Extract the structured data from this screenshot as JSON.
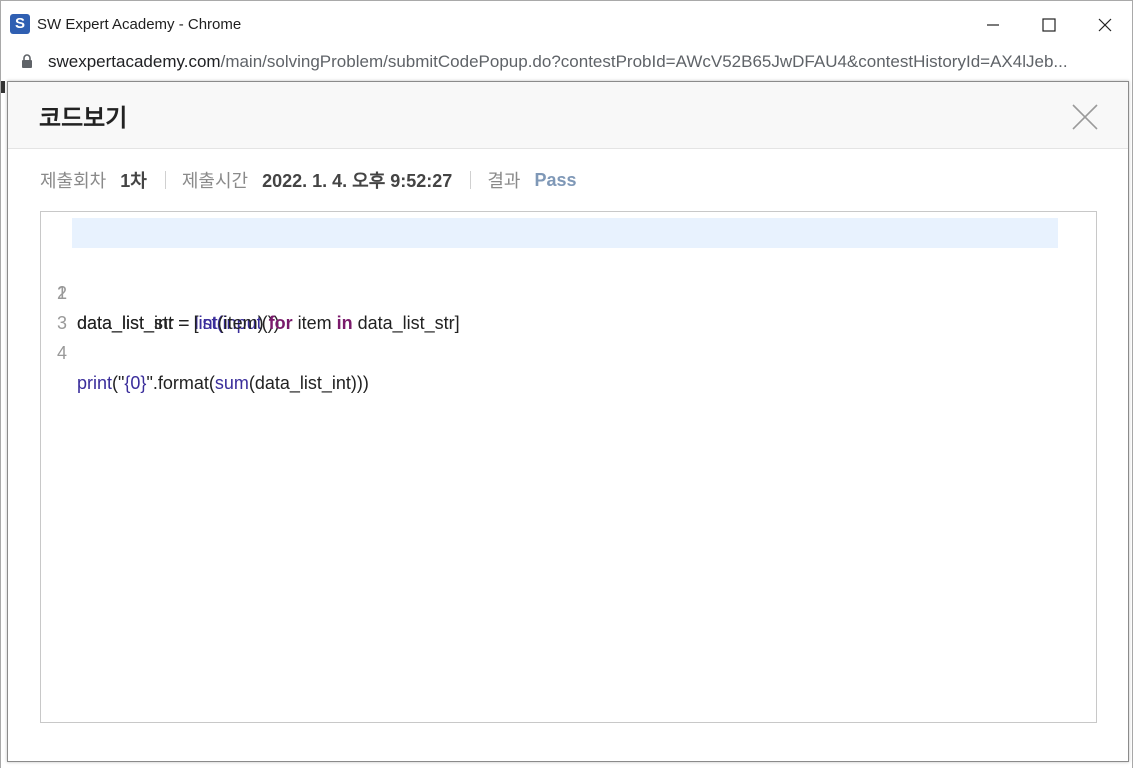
{
  "window": {
    "title": "SW Expert Academy - Chrome",
    "app_icon_letter": "S"
  },
  "address": {
    "host": "swexpertacademy.com",
    "path": "/main/solvingProblem/submitCodePopup.do?contestProbId=AWcV52B65JwDFAU4&contestHistoryId=AX4lJeb..."
  },
  "modal": {
    "title": "코드보기",
    "meta": {
      "submission_label": "제출회차",
      "submission_value": "1차",
      "time_label": "제출시간",
      "time_value": "2022. 1. 4. 오후 9:52:27",
      "result_label": "결과",
      "result_value": "Pass"
    }
  },
  "code": {
    "line_numbers": [
      "1",
      "2",
      "3",
      "4"
    ],
    "line1": {
      "a": "data_list_str = ",
      "b": "list",
      "c": "(",
      "d": "input",
      "e": "())"
    },
    "line2": {
      "a": "data_list_int = [",
      "b": "int",
      "c": "(item) ",
      "d": "for",
      "e": " item ",
      "f": "in",
      "g": " data_list_str]"
    },
    "line4": {
      "a": "print",
      "b": "(\"",
      "c": "{0}",
      "d": "\".format(",
      "e": "sum",
      "f": "(data_list_int)))"
    }
  },
  "colors": {
    "accent_pass": "#7f98b7",
    "builtin": "#3a2d9b",
    "keyword": "#7a1a6b",
    "active_line": "#e8f2fe"
  }
}
